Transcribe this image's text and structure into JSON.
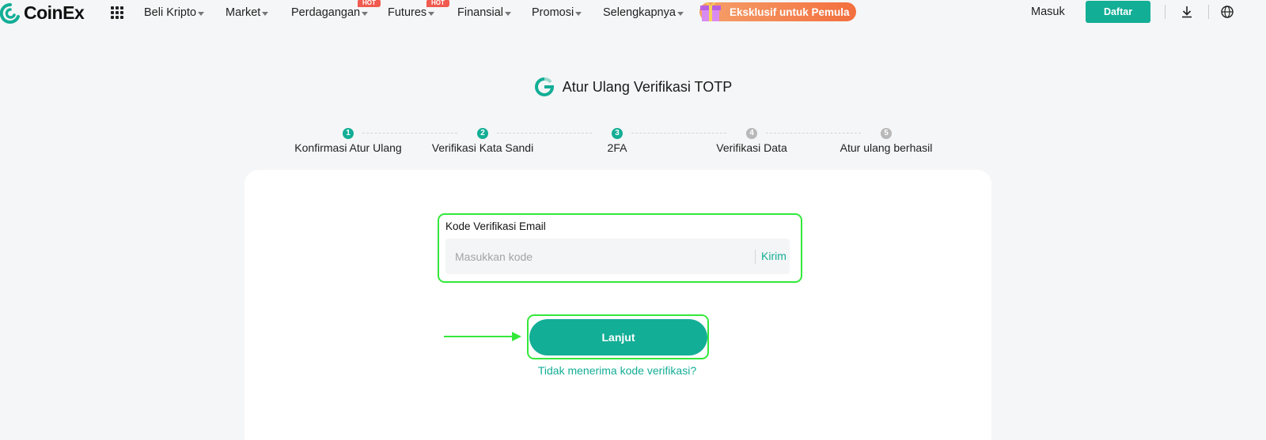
{
  "brand": {
    "name": "CoinEx",
    "accent": "#13ae96"
  },
  "nav": {
    "items": [
      {
        "label": "Beli Kripto",
        "hot": false
      },
      {
        "label": "Market",
        "hot": false
      },
      {
        "label": "Perdagangan",
        "hot": true
      },
      {
        "label": "Futures",
        "hot": true
      },
      {
        "label": "Finansial",
        "hot": false
      },
      {
        "label": "Promosi",
        "hot": false
      },
      {
        "label": "Selengkapnya",
        "hot": false
      }
    ],
    "hot_badge": "HOT",
    "promo_label": "Eksklusif untuk Pemula",
    "login_label": "Masuk",
    "register_label": "Daftar",
    "icons": [
      "apps-grid-icon",
      "download-icon",
      "globe-icon"
    ]
  },
  "page": {
    "title": "Atur Ulang Verifikasi TOTP",
    "steps": [
      {
        "num": "1",
        "label": "Konfirmasi Atur Ulang",
        "active": true
      },
      {
        "num": "2",
        "label": "Verifikasi Kata Sandi",
        "active": true
      },
      {
        "num": "3",
        "label": "2FA",
        "active": true
      },
      {
        "num": "4",
        "label": "Verifikasi Data",
        "active": false
      },
      {
        "num": "5",
        "label": "Atur ulang berhasil",
        "active": false
      }
    ]
  },
  "form": {
    "field_label": "Kode Verifikasi Email",
    "placeholder": "Masukkan kode",
    "value": "",
    "send_label": "Kirim",
    "submit_label": "Lanjut",
    "help_link": "Tidak menerima kode verifikasi?"
  },
  "annotations": {
    "highlight_color": "#33e83a"
  }
}
